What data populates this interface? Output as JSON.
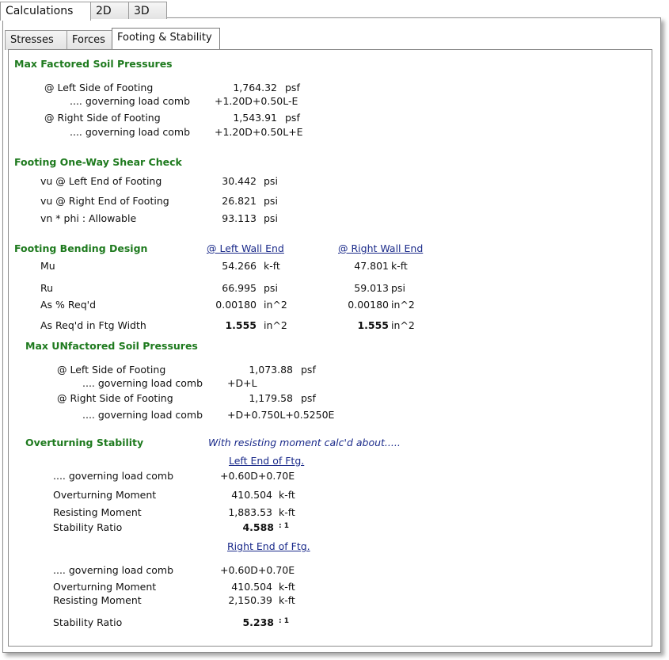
{
  "tabs": {
    "calculations": "Calculations",
    "t2d": "2D",
    "t3d": "3D"
  },
  "subtabs": {
    "stresses": "Stresses",
    "forces": "Forces",
    "footing": "Footing & Stability"
  },
  "soil": {
    "title": "Max Factored Soil Pressures",
    "left_label": "@ Left Side of Footing",
    "left_value": "1,764.32",
    "left_unit": "psf",
    "left_comb_label": ".... governing load comb",
    "left_comb": "+1.20D+0.50L-E",
    "right_label": "@ Right Side of Footing",
    "right_value": "1,543.91",
    "right_unit": "psf",
    "right_comb_label": ".... governing load comb",
    "right_comb": "+1.20D+0.50L+E"
  },
  "shear": {
    "title": "Footing One-Way Shear Check",
    "vu_left_label": "vu @ Left End of Footing",
    "vu_left": "30.442",
    "vu_left_unit": "psi",
    "vu_right_label": "vu @ Right End of Footing",
    "vu_right": "26.821",
    "vu_right_unit": "psi",
    "vn_label": "vn * phi : Allowable",
    "vn": "93.113",
    "vn_unit": "psi"
  },
  "bending": {
    "title": "Footing Bending Design",
    "left_header": "@ Left Wall End",
    "right_header": "@ Right Wall End",
    "mu_label": "Mu",
    "mu_left": "54.266",
    "mu_right": "47.801",
    "mu_unit": "k-ft",
    "ru_label": "Ru",
    "ru_left": "66.995",
    "ru_right": "59.013",
    "ru_unit": "psi",
    "as_pct_label": "As % Req'd",
    "as_pct_left": "0.00180",
    "as_pct_right": "0.00180",
    "as_pct_unit": "in^2",
    "as_req_label": "As Req'd in Ftg Width",
    "as_req_left": "1.555",
    "as_req_right": "1.555",
    "as_req_unit": "in^2"
  },
  "unfactored": {
    "title": "Max UNfactored Soil Pressures",
    "left_label": "@ Left Side of Footing",
    "left_value": "1,073.88",
    "left_unit": "psf",
    "left_comb_label": ".... governing load comb",
    "left_comb": "+D+L",
    "right_label": "@ Right Side of Footing",
    "right_value": "1,179.58",
    "right_unit": "psf",
    "right_comb_label": ".... governing load comb",
    "right_comb": "+D+0.750L+0.5250E"
  },
  "overturning": {
    "title": "Overturning Stability",
    "note": "With resisting moment calc'd about.....",
    "left_header": "Left End of Ftg.",
    "right_header": "Right End of Ftg.",
    "comb_label": ".... governing load comb",
    "ot_label": "Overturning Moment",
    "rm_label": "Resisting Moment",
    "sr_label": "Stability Ratio",
    "moment_unit": "k-ft",
    "ratio_suffix": ": 1",
    "left": {
      "comb": "+0.60D+0.70E",
      "ot": "410.504",
      "rm": "1,883.53",
      "sr": "4.588"
    },
    "right": {
      "comb": "+0.60D+0.70E",
      "ot": "410.504",
      "rm": "2,150.39",
      "sr": "5.238"
    }
  }
}
